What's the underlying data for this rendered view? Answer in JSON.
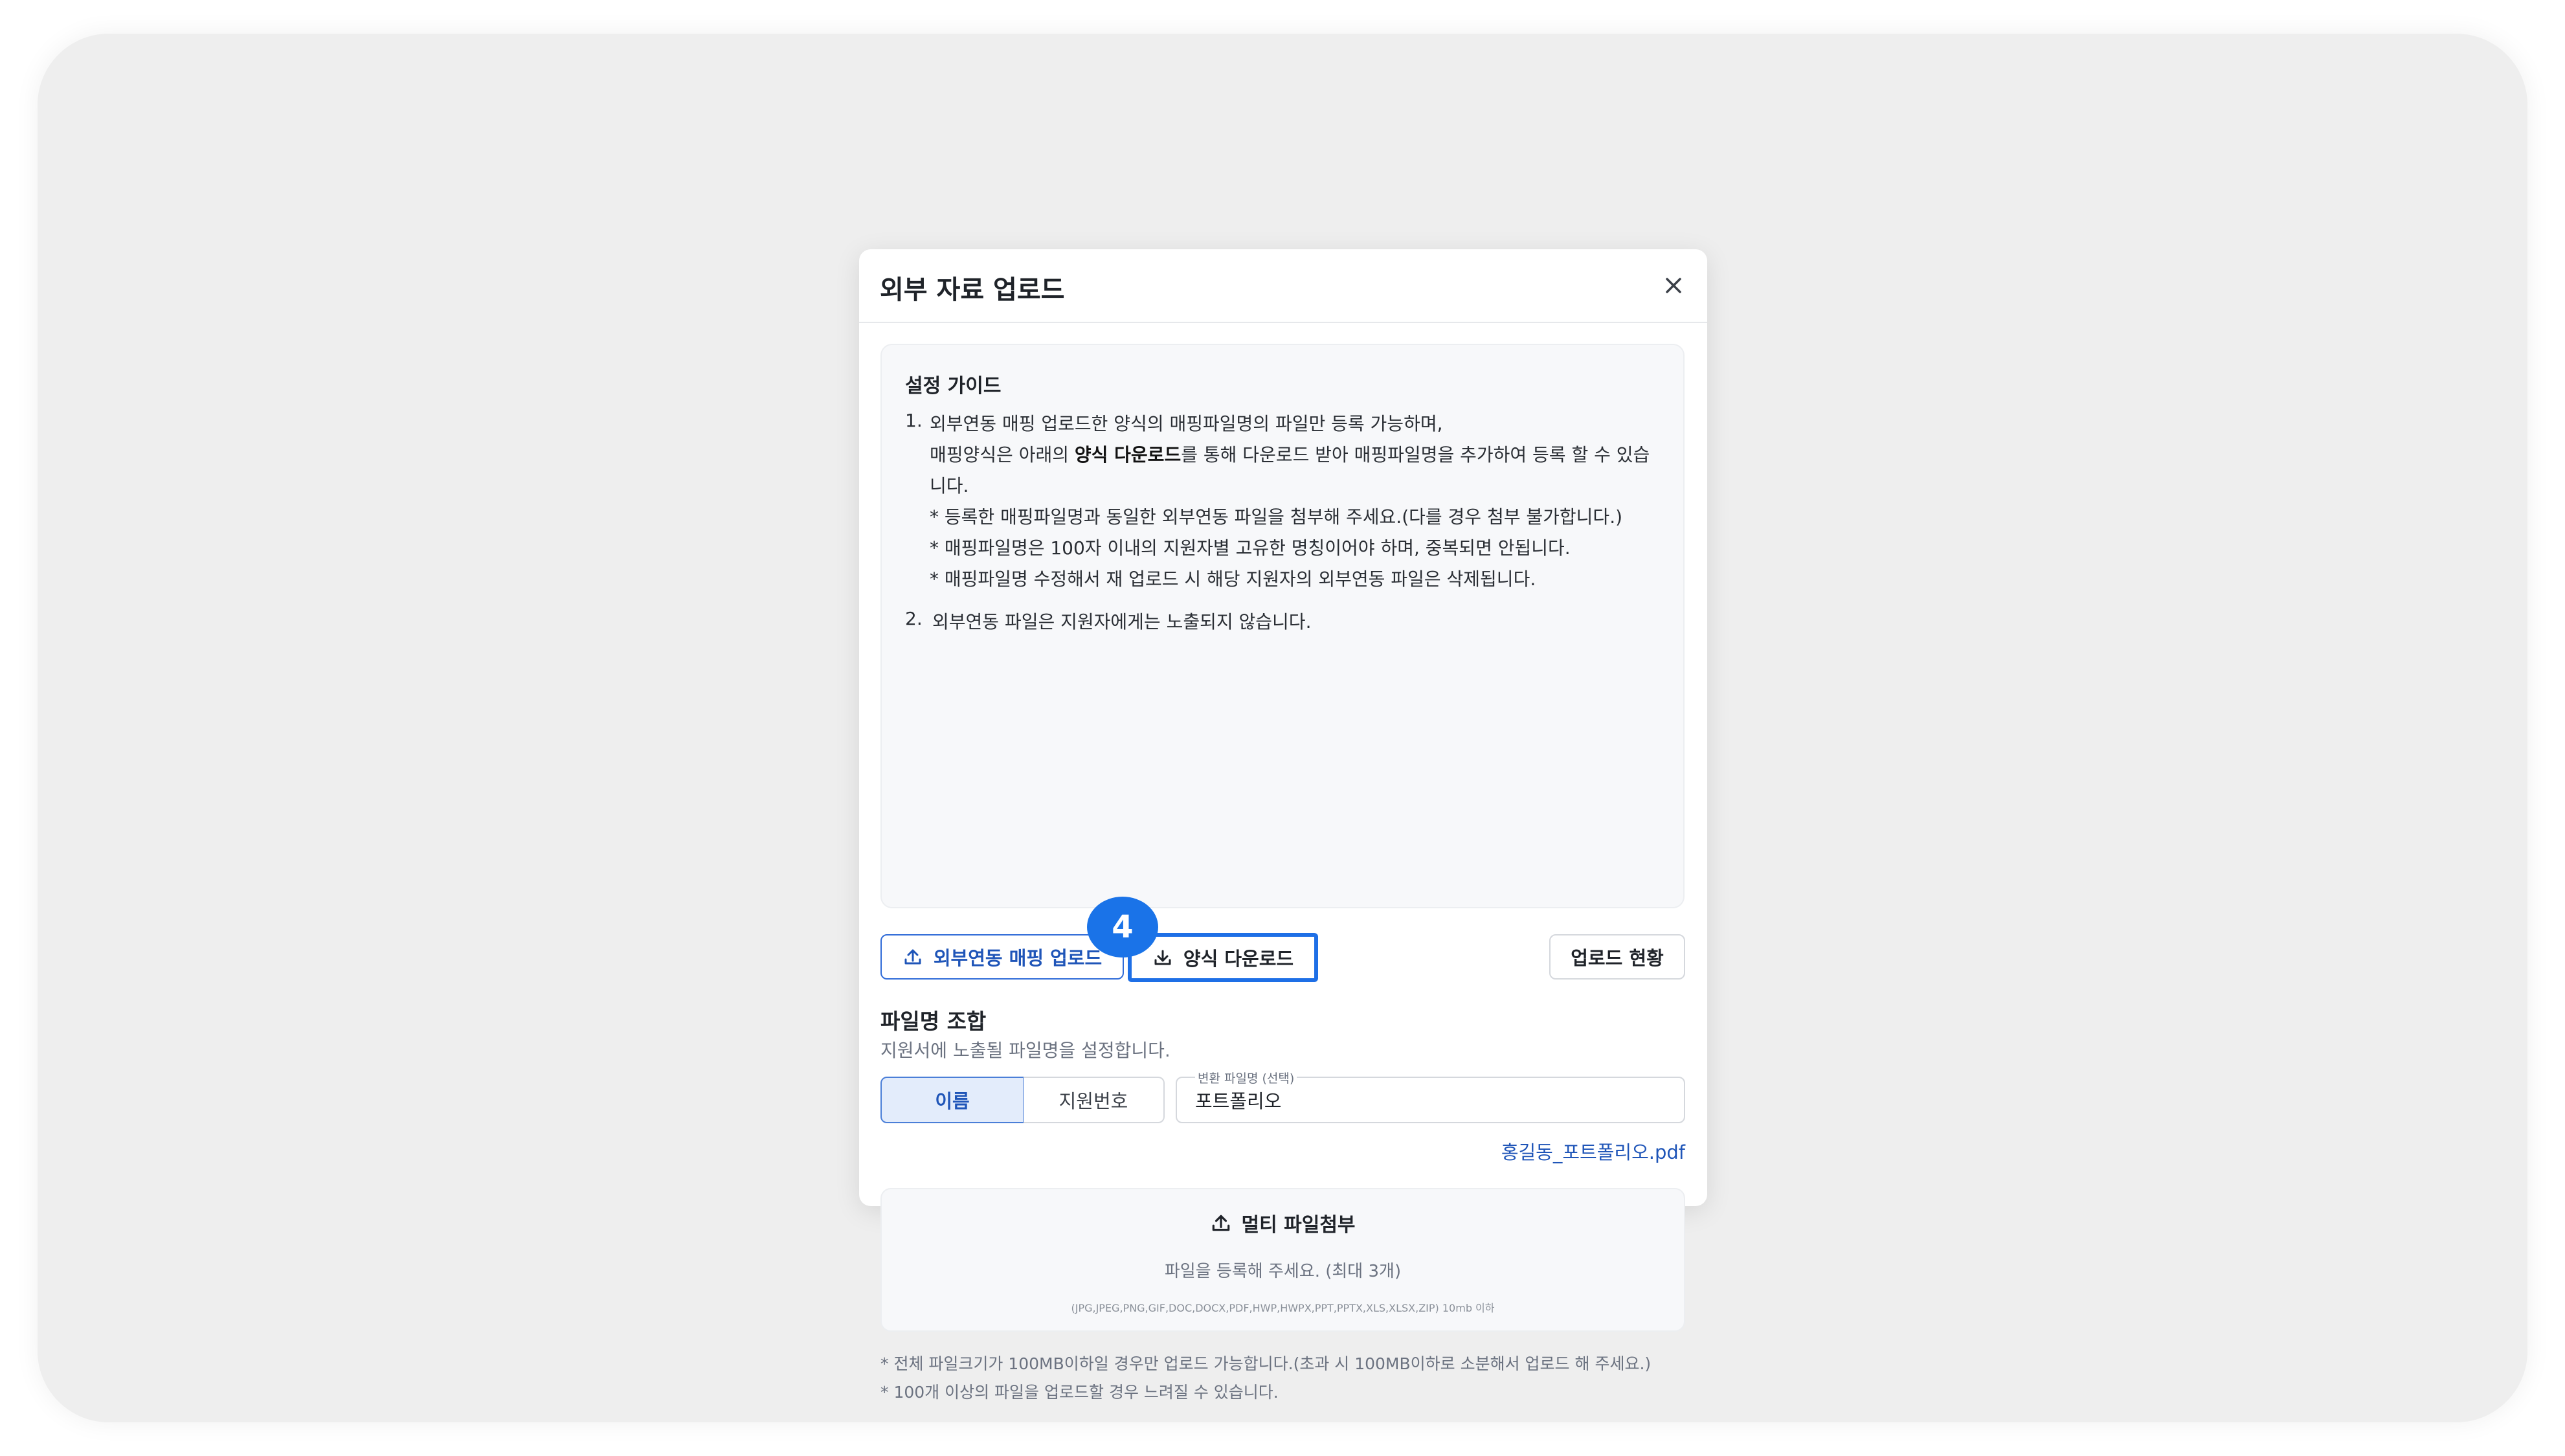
{
  "modal": {
    "title": "외부 자료 업로드"
  },
  "guide": {
    "title": "설정 가이드",
    "item1_num": "1.",
    "item1_line1": "외부연동 매핑 업로드한 양식의 매핑파일명의 파일만 등록 가능하며,",
    "item1_line2_pre": "매핑양식은 아래의 ",
    "item1_line2_bold": "양식 다운로드",
    "item1_line2_post": "를 통해 다운로드 받아 매핑파일명을 추가하여 등록 할 수 있습",
    "item1_line3": "니다.",
    "note_a": "* 등록한 매핑파일명과 동일한 외부연동 파일을 첨부해 주세요.(다를 경우 첨부 불가합니다.)",
    "note_b": "* 매핑파일명은 100자 이내의 지원자별 고유한 명칭이어야 하며, 중복되면 안됩니다.",
    "note_c": "* 매핑파일명 수정해서 재 업로드 시 해당 지원자의 외부연동 파일은 삭제됩니다.",
    "item2_num": "2.",
    "item2_text": "외부연동 파일은 지원자에게는 노출되지 않습니다."
  },
  "actions": {
    "mapping_upload_label": "외부연동 매핑 업로드",
    "template_download_label": "양식 다운로드",
    "upload_status_label": "업로드 현황",
    "step_badge": "4"
  },
  "filename": {
    "title": "파일명 조합",
    "description": "지원서에 노출될 파일명을 설정합니다.",
    "option_name": "이름",
    "option_number": "지원번호",
    "field_label": "변환 파일명 (선택)",
    "field_value": "포트폴리오",
    "preview": "홍길동_포트폴리오.pdf"
  },
  "dropzone": {
    "title": "멀티 파일첨부",
    "subtitle": "파일을 등록해 주세요. (최대 3개)",
    "types": "(JPG,JPEG,PNG,GIF,DOC,DOCX,PDF,HWP,HWPX,PPT,PPTX,XLS,XLSX,ZIP) 10mb 이하"
  },
  "footer": {
    "note1": "* 전체 파일크기가 100MB이하일 경우만 업로드 가능합니다.(초과 시 100MB이하로 소분해서 업로드 해 주세요.)",
    "note2": "* 100개 이상의 파일을 업로드할 경우 느려질 수 있습니다."
  },
  "colors": {
    "accent": "#1f55b8",
    "highlight": "#1e6fe6",
    "badge": "#1a73e8"
  },
  "icons": {
    "close": "close-icon",
    "upload": "upload-icon",
    "download": "download-icon"
  }
}
